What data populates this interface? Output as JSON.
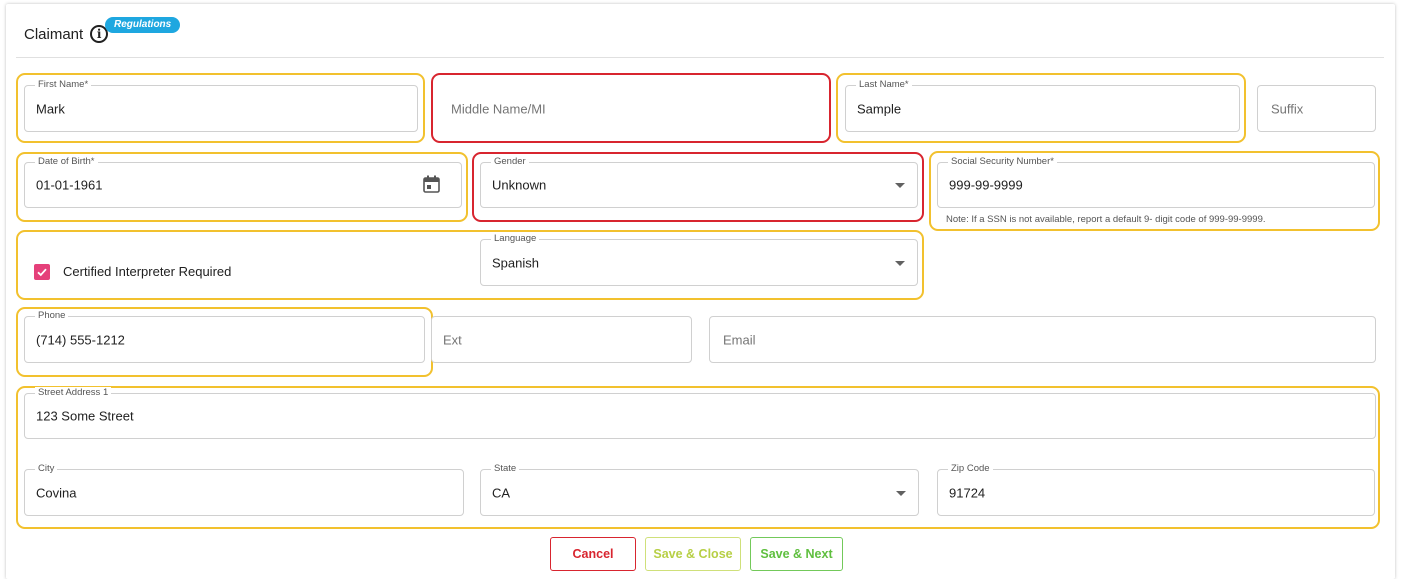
{
  "header": {
    "title": "Claimant",
    "info_icon": "info-icon",
    "badge": "Regulations"
  },
  "fields": {
    "first_name": {
      "label": "First Name*",
      "value": "Mark"
    },
    "middle_name": {
      "placeholder": "Middle Name/MI"
    },
    "last_name": {
      "label": "Last Name*",
      "value": "Sample"
    },
    "suffix": {
      "placeholder": "Suffix"
    },
    "dob": {
      "label": "Date of Birth*",
      "value": "01-01-1961",
      "icon": "calendar-icon"
    },
    "gender": {
      "label": "Gender",
      "value": "Unknown"
    },
    "ssn": {
      "label": "Social Security Number*",
      "value": "999-99-9999",
      "note": "Note: If a SSN is not available, report a default 9- digit code of 999-99-9999."
    },
    "interpreter": {
      "label": "Certified Interpreter Required",
      "checked": true
    },
    "language": {
      "label": "Language",
      "value": "Spanish"
    },
    "phone": {
      "label": "Phone",
      "value": "(714) 555-1212"
    },
    "ext": {
      "placeholder": "Ext"
    },
    "email": {
      "placeholder": "Email"
    },
    "street1": {
      "label": "Street Address 1",
      "value": "123 Some Street"
    },
    "city": {
      "label": "City",
      "value": "Covina"
    },
    "state": {
      "label": "State",
      "value": "CA"
    },
    "zip": {
      "label": "Zip Code",
      "value": "91724"
    }
  },
  "buttons": {
    "cancel": "Cancel",
    "save_close": "Save & Close",
    "save_next": "Save & Next"
  },
  "colors": {
    "highlight_yellow": "#f2c12e",
    "highlight_red": "#d8252f",
    "badge": "#1ea7e0",
    "checkbox": "#e5407a",
    "cancel": "#d8252f",
    "save_close": "#b7cf45",
    "save_next": "#5fbf3f"
  }
}
